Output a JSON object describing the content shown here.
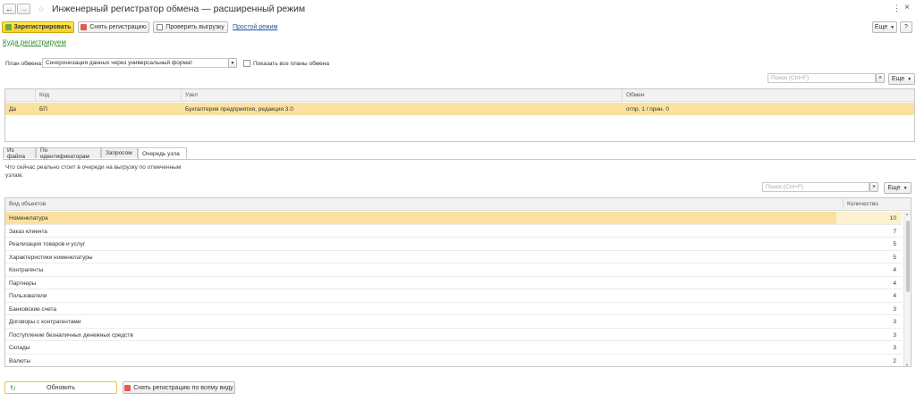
{
  "window": {
    "title": "Инженерный регистратор обмена — расширенный режим"
  },
  "toolbar": {
    "register_label": "Зарегистрировать",
    "unregister_label": "Снять регистрацию",
    "check_upload_label": "Проверить выгрузку",
    "simple_mode_label": "Простой режим",
    "more_label": "Еще",
    "where_register_label": "Куда регистрируем"
  },
  "exchange_plan": {
    "label": "План обмена:",
    "value": "Синхронизация данных через универсальный формат",
    "show_all_label": "Показать все планы обмена"
  },
  "nodes_search": {
    "placeholder": "Поиск (Ctrl+F)",
    "more_label": "Еще"
  },
  "nodes_table": {
    "columns": [
      "",
      "Код",
      "Узел",
      "Обмен"
    ],
    "rows": [
      {
        "flag": "Да",
        "code": "БП",
        "node": "Бухгалтерия предприятия, редакция 3.0",
        "exchange": "отпр. 1 / прин. 0"
      }
    ]
  },
  "tabs": [
    {
      "label": "Из файла"
    },
    {
      "label": "По идентификаторам"
    },
    {
      "label": "Запросом"
    },
    {
      "label": "Очередь узла"
    }
  ],
  "queue": {
    "description": "Что сейчас реально стоит в очереди на выгрузку по отмеченным узлам.",
    "search_placeholder": "Поиск (Ctrl+F)",
    "more_label": "Еще",
    "columns": {
      "kind": "Вид объектов",
      "count": "Количество"
    },
    "rows": [
      {
        "kind": "Номенклатура",
        "count": "10"
      },
      {
        "kind": "Заказ клиента",
        "count": "7"
      },
      {
        "kind": "Реализация товаров и услуг",
        "count": "5"
      },
      {
        "kind": "Характеристики номенклатуры",
        "count": "5"
      },
      {
        "kind": "Контрагенты",
        "count": "4"
      },
      {
        "kind": "Партнеры",
        "count": "4"
      },
      {
        "kind": "Пользователи",
        "count": "4"
      },
      {
        "kind": "Банковские счета",
        "count": "3"
      },
      {
        "kind": "Договоры с контрагентами",
        "count": "3"
      },
      {
        "kind": "Поступление безналичных денежных средств",
        "count": "3"
      },
      {
        "kind": "Склады",
        "count": "3"
      },
      {
        "kind": "Валюты",
        "count": "2"
      }
    ]
  },
  "bottom": {
    "refresh_label": "Обновить",
    "unregister_all_label": "Снять регистрацию по всему виду"
  },
  "colors": {
    "accent_yellow": "#f5cf2a",
    "selection": "#fbe1a0",
    "link_green": "#2e8b2e",
    "link_blue": "#1a53a8"
  }
}
